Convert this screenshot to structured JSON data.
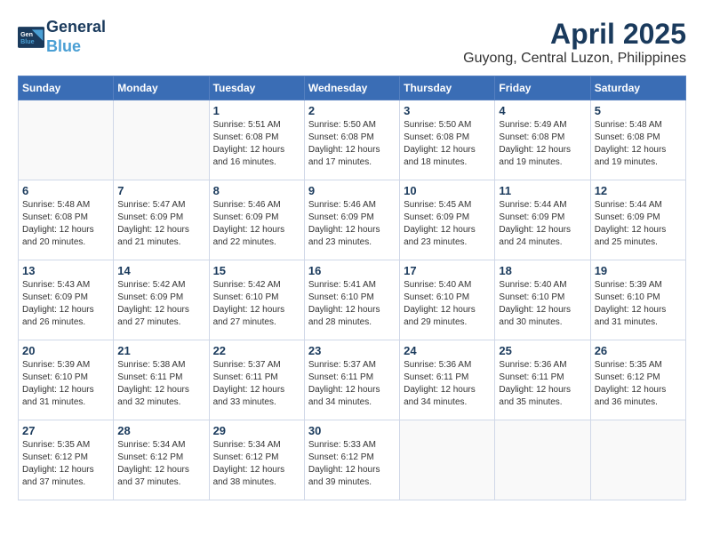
{
  "header": {
    "logo_line1": "General",
    "logo_line2": "Blue",
    "month_title": "April 2025",
    "subtitle": "Guyong, Central Luzon, Philippines"
  },
  "days_of_week": [
    "Sunday",
    "Monday",
    "Tuesday",
    "Wednesday",
    "Thursday",
    "Friday",
    "Saturday"
  ],
  "weeks": [
    [
      {
        "day": "",
        "info": ""
      },
      {
        "day": "",
        "info": ""
      },
      {
        "day": "1",
        "info": "Sunrise: 5:51 AM\nSunset: 6:08 PM\nDaylight: 12 hours and 16 minutes."
      },
      {
        "day": "2",
        "info": "Sunrise: 5:50 AM\nSunset: 6:08 PM\nDaylight: 12 hours and 17 minutes."
      },
      {
        "day": "3",
        "info": "Sunrise: 5:50 AM\nSunset: 6:08 PM\nDaylight: 12 hours and 18 minutes."
      },
      {
        "day": "4",
        "info": "Sunrise: 5:49 AM\nSunset: 6:08 PM\nDaylight: 12 hours and 19 minutes."
      },
      {
        "day": "5",
        "info": "Sunrise: 5:48 AM\nSunset: 6:08 PM\nDaylight: 12 hours and 19 minutes."
      }
    ],
    [
      {
        "day": "6",
        "info": "Sunrise: 5:48 AM\nSunset: 6:08 PM\nDaylight: 12 hours and 20 minutes."
      },
      {
        "day": "7",
        "info": "Sunrise: 5:47 AM\nSunset: 6:09 PM\nDaylight: 12 hours and 21 minutes."
      },
      {
        "day": "8",
        "info": "Sunrise: 5:46 AM\nSunset: 6:09 PM\nDaylight: 12 hours and 22 minutes."
      },
      {
        "day": "9",
        "info": "Sunrise: 5:46 AM\nSunset: 6:09 PM\nDaylight: 12 hours and 23 minutes."
      },
      {
        "day": "10",
        "info": "Sunrise: 5:45 AM\nSunset: 6:09 PM\nDaylight: 12 hours and 23 minutes."
      },
      {
        "day": "11",
        "info": "Sunrise: 5:44 AM\nSunset: 6:09 PM\nDaylight: 12 hours and 24 minutes."
      },
      {
        "day": "12",
        "info": "Sunrise: 5:44 AM\nSunset: 6:09 PM\nDaylight: 12 hours and 25 minutes."
      }
    ],
    [
      {
        "day": "13",
        "info": "Sunrise: 5:43 AM\nSunset: 6:09 PM\nDaylight: 12 hours and 26 minutes."
      },
      {
        "day": "14",
        "info": "Sunrise: 5:42 AM\nSunset: 6:09 PM\nDaylight: 12 hours and 27 minutes."
      },
      {
        "day": "15",
        "info": "Sunrise: 5:42 AM\nSunset: 6:10 PM\nDaylight: 12 hours and 27 minutes."
      },
      {
        "day": "16",
        "info": "Sunrise: 5:41 AM\nSunset: 6:10 PM\nDaylight: 12 hours and 28 minutes."
      },
      {
        "day": "17",
        "info": "Sunrise: 5:40 AM\nSunset: 6:10 PM\nDaylight: 12 hours and 29 minutes."
      },
      {
        "day": "18",
        "info": "Sunrise: 5:40 AM\nSunset: 6:10 PM\nDaylight: 12 hours and 30 minutes."
      },
      {
        "day": "19",
        "info": "Sunrise: 5:39 AM\nSunset: 6:10 PM\nDaylight: 12 hours and 31 minutes."
      }
    ],
    [
      {
        "day": "20",
        "info": "Sunrise: 5:39 AM\nSunset: 6:10 PM\nDaylight: 12 hours and 31 minutes."
      },
      {
        "day": "21",
        "info": "Sunrise: 5:38 AM\nSunset: 6:11 PM\nDaylight: 12 hours and 32 minutes."
      },
      {
        "day": "22",
        "info": "Sunrise: 5:37 AM\nSunset: 6:11 PM\nDaylight: 12 hours and 33 minutes."
      },
      {
        "day": "23",
        "info": "Sunrise: 5:37 AM\nSunset: 6:11 PM\nDaylight: 12 hours and 34 minutes."
      },
      {
        "day": "24",
        "info": "Sunrise: 5:36 AM\nSunset: 6:11 PM\nDaylight: 12 hours and 34 minutes."
      },
      {
        "day": "25",
        "info": "Sunrise: 5:36 AM\nSunset: 6:11 PM\nDaylight: 12 hours and 35 minutes."
      },
      {
        "day": "26",
        "info": "Sunrise: 5:35 AM\nSunset: 6:12 PM\nDaylight: 12 hours and 36 minutes."
      }
    ],
    [
      {
        "day": "27",
        "info": "Sunrise: 5:35 AM\nSunset: 6:12 PM\nDaylight: 12 hours and 37 minutes."
      },
      {
        "day": "28",
        "info": "Sunrise: 5:34 AM\nSunset: 6:12 PM\nDaylight: 12 hours and 37 minutes."
      },
      {
        "day": "29",
        "info": "Sunrise: 5:34 AM\nSunset: 6:12 PM\nDaylight: 12 hours and 38 minutes."
      },
      {
        "day": "30",
        "info": "Sunrise: 5:33 AM\nSunset: 6:12 PM\nDaylight: 12 hours and 39 minutes."
      },
      {
        "day": "",
        "info": ""
      },
      {
        "day": "",
        "info": ""
      },
      {
        "day": "",
        "info": ""
      }
    ]
  ]
}
